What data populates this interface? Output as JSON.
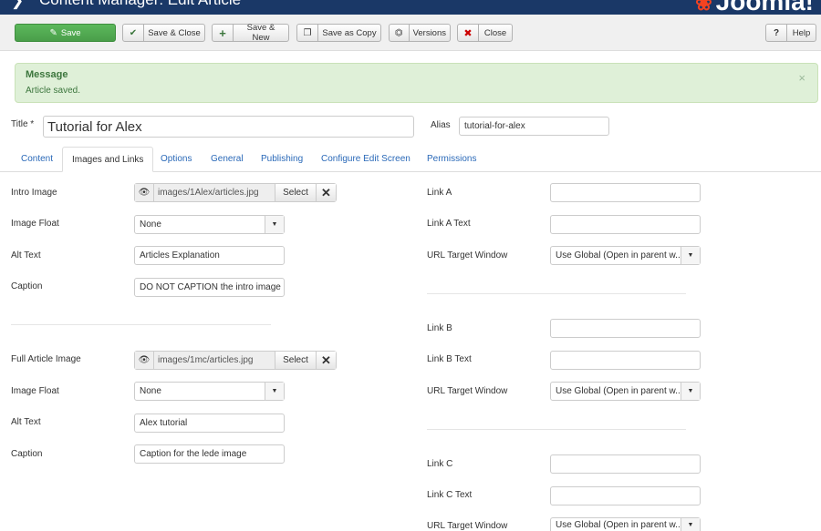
{
  "header": {
    "title": "Content Manager: Edit Article",
    "logo": "Joomla!"
  },
  "toolbar": {
    "save": "Save",
    "save_close": "Save & Close",
    "save_new": "Save & New",
    "save_copy": "Save as Copy",
    "versions": "Versions",
    "close": "Close",
    "help": "Help"
  },
  "alert": {
    "heading": "Message",
    "text": "Article saved."
  },
  "title_field": {
    "label": "Title *",
    "value": "Tutorial for Alex"
  },
  "alias_field": {
    "label": "Alias",
    "value": "tutorial-for-alex"
  },
  "tabs": [
    "Content",
    "Images and Links",
    "Options",
    "General",
    "Publishing",
    "Configure Edit Screen",
    "Permissions"
  ],
  "active_tab": "Images and Links",
  "intro": {
    "image_label": "Intro Image",
    "image_path": "images/1Alex/articles.jpg",
    "select": "Select",
    "float_label": "Image Float",
    "float_value": "None",
    "alt_label": "Alt Text",
    "alt_value": "Articles Explanation",
    "caption_label": "Caption",
    "caption_value": "DO NOT CAPTION the intro image"
  },
  "full": {
    "image_label": "Full Article Image",
    "image_path": "images/1mc/articles.jpg",
    "select": "Select",
    "float_label": "Image Float",
    "float_value": "None",
    "alt_label": "Alt Text",
    "alt_value": "Alex tutorial",
    "caption_label": "Caption",
    "caption_value": "Caption for the lede image"
  },
  "links": {
    "a_label": "Link A",
    "a_text_label": "Link A Text",
    "b_label": "Link B",
    "b_text_label": "Link B Text",
    "c_label": "Link C",
    "c_text_label": "Link C Text",
    "target_label": "URL Target Window",
    "target_value": "Use Global (Open in parent w..."
  }
}
